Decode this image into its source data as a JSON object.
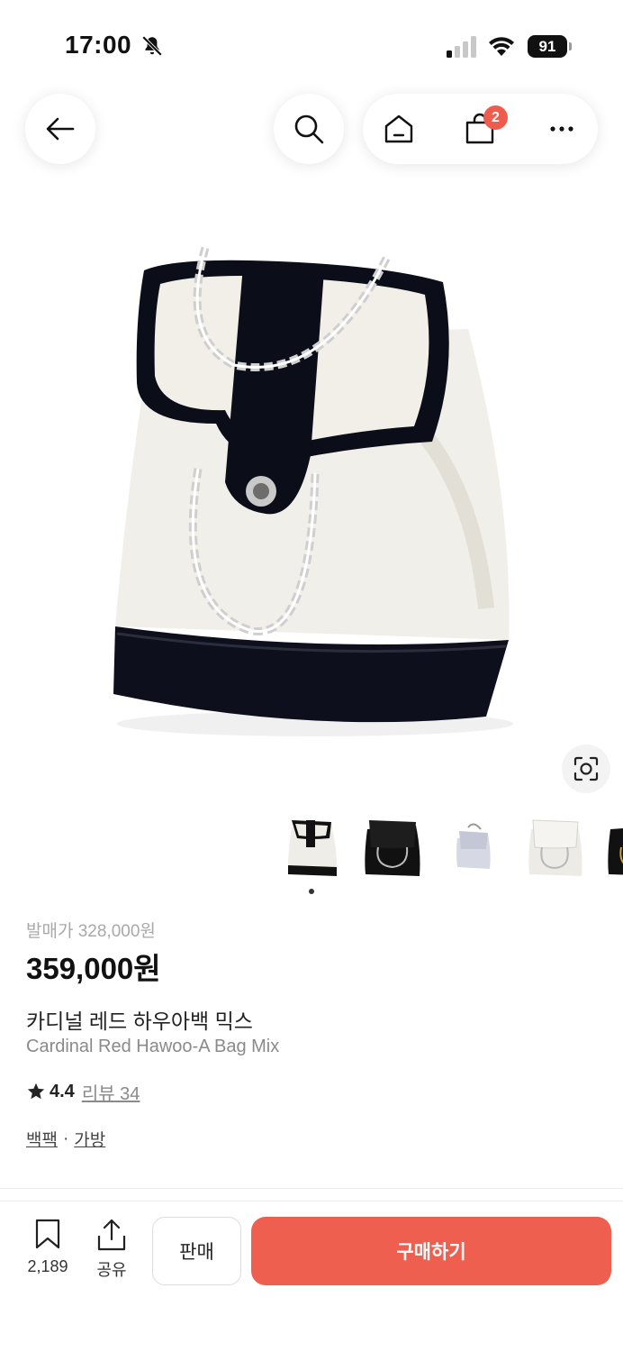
{
  "status_bar": {
    "time": "17:00",
    "battery": "91"
  },
  "nav": {
    "cart_badge": "2"
  },
  "product": {
    "original_price": "발매가 328,000원",
    "price": "359,000원",
    "title_ko": "카디널 레드 하우아백 믹스",
    "title_en": "Cardinal Red Hawoo-A Bag Mix",
    "rating": "4.4",
    "review_link": "리뷰 34",
    "categories": [
      "백팩",
      "가방"
    ],
    "category_separator": "·"
  },
  "thumbnails": [
    {
      "name": "white-black-mix"
    },
    {
      "name": "black"
    },
    {
      "name": "silver"
    },
    {
      "name": "white"
    },
    {
      "name": "black-gold"
    }
  ],
  "bottom_bar": {
    "save_count": "2,189",
    "share_label": "공유",
    "sell_label": "판매",
    "buy_label": "구매하기"
  },
  "colors": {
    "accent": "#ef5f4f",
    "badge": "#ef5b4c"
  }
}
